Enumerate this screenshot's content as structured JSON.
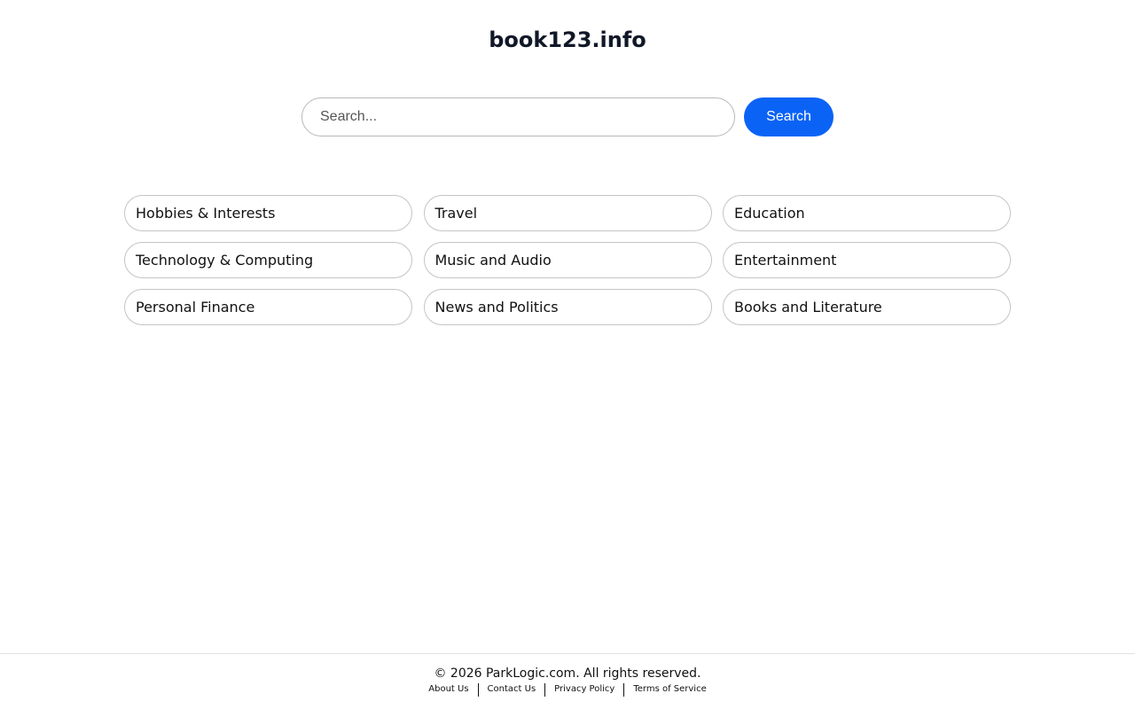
{
  "site": {
    "title": "book123.info"
  },
  "search": {
    "placeholder": "Search...",
    "button_label": "Search"
  },
  "categories": [
    "Hobbies & Interests",
    "Travel",
    "Education",
    "Technology & Computing",
    "Music and Audio",
    "Entertainment",
    "Personal Finance",
    "News and Politics",
    "Books and Literature"
  ],
  "footer": {
    "copyright": "© 2026 ParkLogic.com. All rights reserved.",
    "links": [
      "About Us",
      "Contact Us",
      "Privacy Policy",
      "Terms of Service"
    ]
  },
  "colors": {
    "accent": "#0b63f6",
    "title": "#111827",
    "border": "#c4c4c4"
  }
}
